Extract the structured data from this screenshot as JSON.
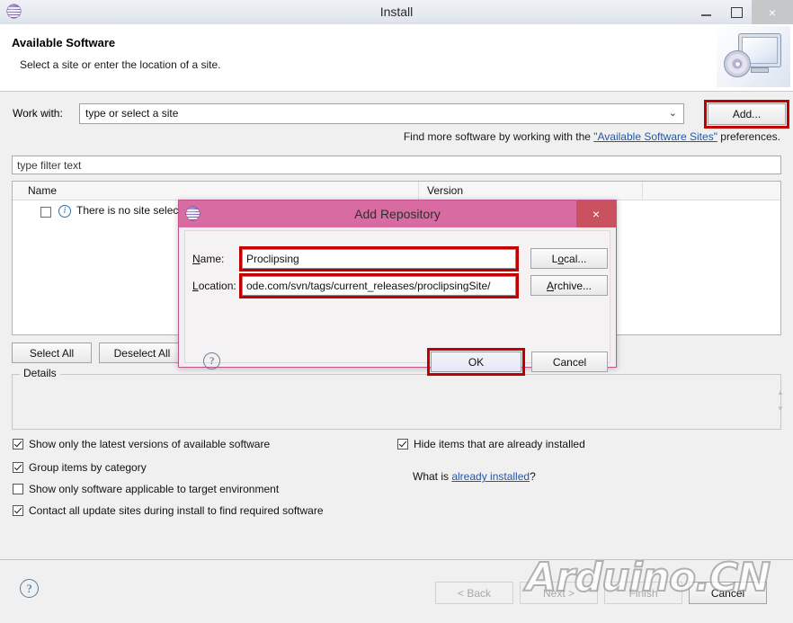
{
  "window": {
    "title": "Install",
    "icon": "eclipse-icon",
    "minimize": "–",
    "maximize": "❑",
    "close": "×"
  },
  "header": {
    "title": "Available Software",
    "subtitle": "Select a site or enter the location of a site.",
    "art_icon": "monitor-cd-icon"
  },
  "work_with": {
    "label": "Work with:",
    "value": "type or select a site",
    "dropdown_arrow": "⌄",
    "add_button": "Add..."
  },
  "hint": {
    "prefix": "Find more software by working with the ",
    "link": "\"Available Software Sites\"",
    "suffix": " preferences."
  },
  "filter": {
    "placeholder": "type filter text"
  },
  "table": {
    "columns": [
      "Name",
      "Version"
    ],
    "rows": [
      {
        "checked": false,
        "icon": "info-icon",
        "name": "There is no site selected",
        "version": ""
      }
    ]
  },
  "list_buttons": {
    "select_all": "Select All",
    "deselect_all": "Deselect All"
  },
  "details": {
    "legend": "Details",
    "content": "",
    "scroll_up": "▲",
    "scroll_down": "▼"
  },
  "options": {
    "left": [
      {
        "label": "Show only the latest versions of available software",
        "checked": true
      },
      {
        "label": "Group items by category",
        "checked": true
      },
      {
        "label": "Show only software applicable to target environment",
        "checked": false
      },
      {
        "label": "Contact all update sites during install to find required software",
        "checked": true
      }
    ],
    "right": [
      {
        "label": "Hide items that are already installed",
        "checked": true
      }
    ],
    "what_is_prefix": "What is ",
    "what_is_link": "already installed",
    "what_is_suffix": "?"
  },
  "footer": {
    "help_icon": "?",
    "back": "< Back",
    "next": "Next >",
    "finish": "Finish",
    "cancel": "Cancel"
  },
  "watermark": {
    "text": "Arduino.CN"
  },
  "dialog": {
    "title": "Add Repository",
    "icon": "eclipse-icon",
    "close": "×",
    "name_label_pre": "N",
    "name_label_post": "ame:",
    "name_value": "Proclipsing",
    "location_label_pre": "L",
    "location_label_post": "ocation:",
    "location_value": "ode.com/svn/tags/current_releases/proclipsingSite/",
    "local_pre": "L",
    "local_mid": "o",
    "local_post": "cal...",
    "archive_pre": "A",
    "archive_post": "rchive...",
    "help_icon": "?",
    "ok": "OK",
    "cancel": "Cancel"
  },
  "colors": {
    "highlight": "#c00000",
    "dialog_title": "#d96ba3",
    "dialog_close": "#c9525e",
    "link": "#2357a6"
  }
}
